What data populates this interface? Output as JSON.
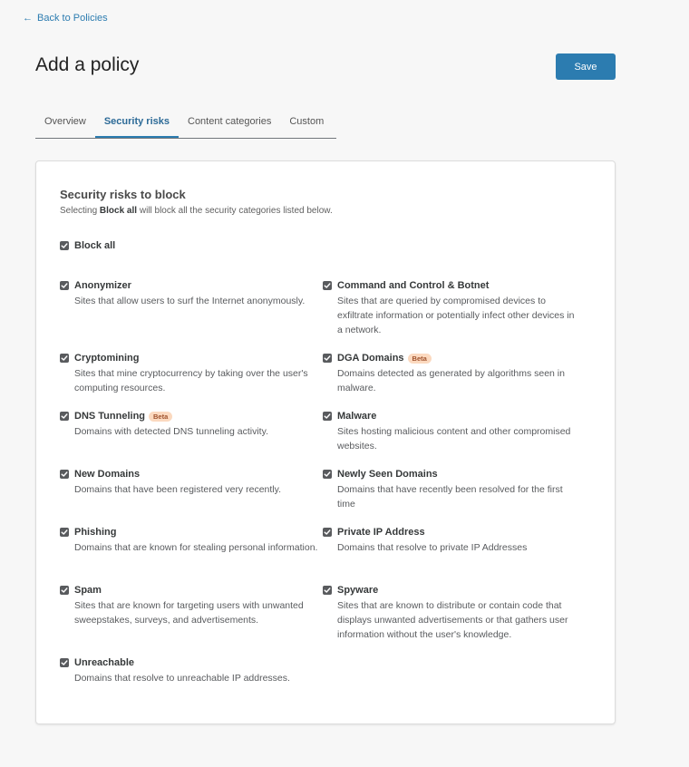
{
  "back_link": "Back to Policies",
  "page_title": "Add a policy",
  "save_label": "Save",
  "tabs": [
    {
      "label": "Overview",
      "active": false
    },
    {
      "label": "Security risks",
      "active": true
    },
    {
      "label": "Content categories",
      "active": false
    },
    {
      "label": "Custom",
      "active": false
    }
  ],
  "card": {
    "title": "Security risks to block",
    "subtitle_pre": "Selecting ",
    "subtitle_bold": "Block all",
    "subtitle_post": " will block all the security categories listed below.",
    "block_all_label": "Block all",
    "block_all_checked": true
  },
  "categories": [
    {
      "name": "Anonymizer",
      "desc": "Sites that allow users to surf the Internet anonymously.",
      "checked": true,
      "badge": ""
    },
    {
      "name": "Command and Control & Botnet",
      "desc": "Sites that are queried by compromised devices to exfiltrate information or potentially infect other devices in a network.",
      "checked": true,
      "badge": ""
    },
    {
      "name": "Cryptomining",
      "desc": "Sites that mine cryptocurrency by taking over the user's computing resources.",
      "checked": true,
      "badge": ""
    },
    {
      "name": "DGA Domains",
      "desc": "Domains detected as generated by algorithms seen in malware.",
      "checked": true,
      "badge": "Beta"
    },
    {
      "name": "DNS Tunneling",
      "desc": "Domains with detected DNS tunneling activity.",
      "checked": true,
      "badge": "Beta"
    },
    {
      "name": "Malware",
      "desc": "Sites hosting malicious content and other compromised websites.",
      "checked": true,
      "badge": ""
    },
    {
      "name": "New Domains",
      "desc": "Domains that have been registered very recently.",
      "checked": true,
      "badge": ""
    },
    {
      "name": "Newly Seen Domains",
      "desc": "Domains that have recently been resolved for the first time",
      "checked": true,
      "badge": ""
    },
    {
      "name": "Phishing",
      "desc": "Domains that are known for stealing personal information.",
      "checked": true,
      "badge": ""
    },
    {
      "name": "Private IP Address",
      "desc": "Domains that resolve to private IP Addresses",
      "checked": true,
      "badge": ""
    },
    {
      "name": "Spam",
      "desc": "Sites that are known for targeting users with unwanted sweepstakes, surveys, and advertisements.",
      "checked": true,
      "badge": ""
    },
    {
      "name": "Spyware",
      "desc": "Sites that are known to distribute or contain code that displays unwanted advertisements or that gathers user information without the user's knowledge.",
      "checked": true,
      "badge": ""
    },
    {
      "name": "Unreachable",
      "desc": "Domains that resolve to unreachable IP addresses.",
      "checked": true,
      "badge": ""
    }
  ],
  "colors": {
    "accent": "#2c7cb0",
    "checkbox": "#595b5e",
    "beta_bg": "#fbd9bf",
    "beta_text": "#a0522d"
  }
}
